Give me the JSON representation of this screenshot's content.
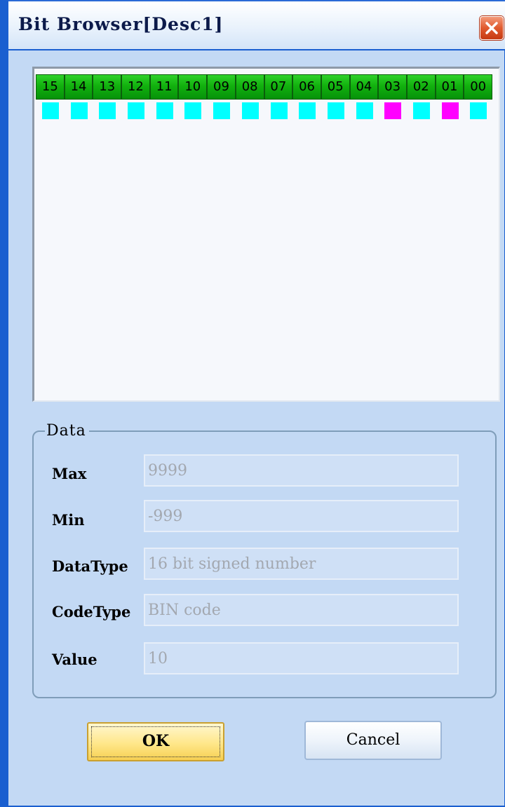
{
  "window": {
    "title": "Bit Browser[Desc1]"
  },
  "bits": {
    "labels": [
      "15",
      "14",
      "13",
      "12",
      "11",
      "10",
      "09",
      "08",
      "07",
      "06",
      "05",
      "04",
      "03",
      "02",
      "01",
      "00"
    ],
    "states": [
      0,
      0,
      0,
      0,
      0,
      0,
      0,
      0,
      0,
      0,
      0,
      0,
      1,
      0,
      1,
      0
    ],
    "off_color": "#00ffff",
    "on_color": "#ff00ff",
    "header_color": "#12b10e"
  },
  "data_group": {
    "legend": "Data",
    "fields": [
      {
        "label": "Max",
        "value": "9999"
      },
      {
        "label": "Min",
        "value": "-999"
      },
      {
        "label": "DataType",
        "value": "16 bit signed number"
      },
      {
        "label": "CodeType",
        "value": "BIN code"
      },
      {
        "label": "Value",
        "value": "10"
      }
    ]
  },
  "buttons": {
    "ok_label": "OK",
    "cancel_label": "Cancel"
  },
  "icons": {
    "close": "close-x-icon"
  }
}
